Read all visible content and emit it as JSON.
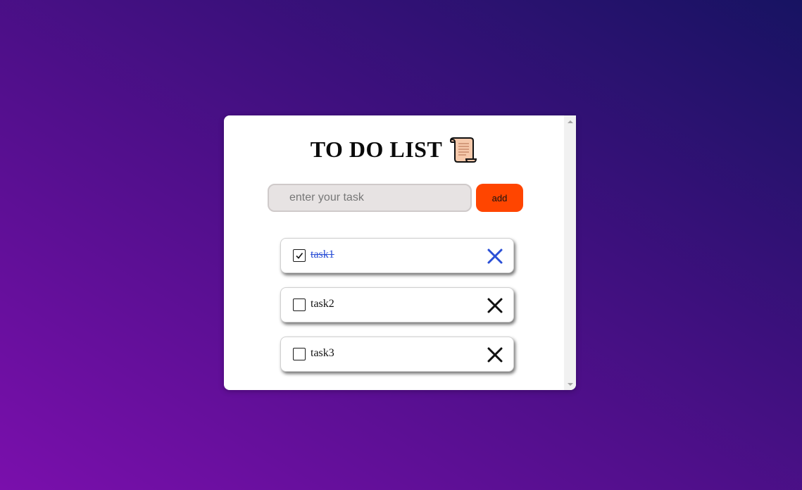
{
  "app": {
    "title": "TO DO LIST",
    "title_icon": "scroll-icon"
  },
  "form": {
    "input_placeholder": "enter your task",
    "input_value": "",
    "add_label": "add"
  },
  "tasks": [
    {
      "label": "task1",
      "done": true
    },
    {
      "label": "task2",
      "done": false
    },
    {
      "label": "task3",
      "done": false
    }
  ],
  "colors": {
    "done_color": "#2a4fd6",
    "add_button": "#ff4500",
    "bg_top": "#171362",
    "bg_bottom": "#7a0fac"
  },
  "icons": {
    "delete": "close-icon",
    "check": "check-icon"
  }
}
